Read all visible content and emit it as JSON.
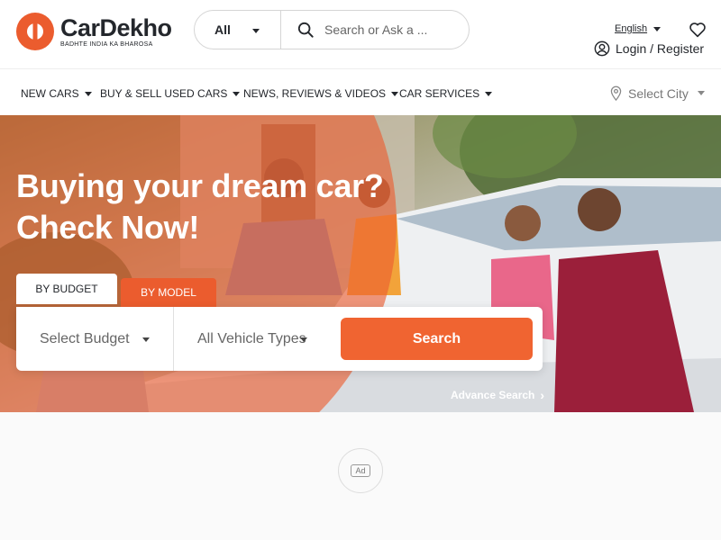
{
  "brand": {
    "name": "CarDekho",
    "tagline": "BADHTE INDIA KA BHAROSA",
    "accent_color": "#eb5c2e"
  },
  "header": {
    "search_category": "All",
    "search_placeholder": "Search or Ask a ...",
    "language": "English",
    "login_label": "Login / Register"
  },
  "nav": {
    "items": [
      {
        "label": "NEW CARS"
      },
      {
        "label": "BUY & SELL USED CARS"
      },
      {
        "label": "NEWS, REVIEWS & VIDEOS"
      },
      {
        "label": "CAR SERVICES"
      }
    ],
    "city_placeholder": "Select City"
  },
  "hero": {
    "title_line1": "Buying your dream car?",
    "title_line2": "Check Now!",
    "tabs": [
      {
        "label": "BY BUDGET",
        "active": true
      },
      {
        "label": "BY MODEL",
        "active": false
      }
    ],
    "budget_select": "Select Budget",
    "vehicle_select": "All Vehicle Types",
    "search_button": "Search",
    "advance_search": "Advance Search"
  },
  "ad": {
    "label": "Ad"
  },
  "icons": [
    "cardekho-logo-icon",
    "search-icon",
    "heart-icon",
    "user-circle-icon",
    "location-pin-icon",
    "chevron-right-icon"
  ]
}
